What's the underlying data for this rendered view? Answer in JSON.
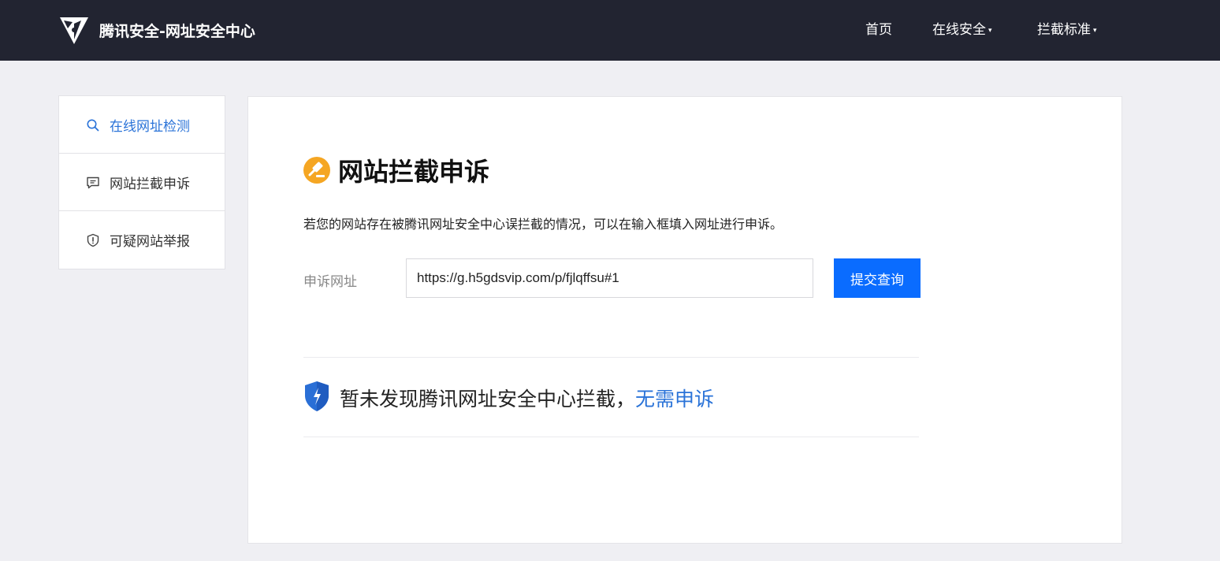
{
  "header": {
    "brand_title": "腾讯安全-网址安全中心",
    "logo_icon": "tencent-security-logo-icon",
    "nav": [
      {
        "label": "首页",
        "dropdown": false
      },
      {
        "label": "在线安全",
        "dropdown": true
      },
      {
        "label": "拦截标准",
        "dropdown": true
      }
    ],
    "caret": "▾"
  },
  "sidebar": {
    "items": [
      {
        "label": "在线网址检测",
        "icon": "search-icon",
        "active": true
      },
      {
        "label": "网站拦截申诉",
        "icon": "message-icon",
        "active": false
      },
      {
        "label": "可疑网站举报",
        "icon": "shield-alert-icon",
        "active": false
      }
    ]
  },
  "main": {
    "title": "网站拦截申诉",
    "title_icon": "gavel-icon",
    "description": "若您的网站存在被腾讯网址安全中心误拦截的情况，可以在输入框填入网址进行申诉。",
    "field_label": "申诉网址",
    "url_value": "https://g.h5gdsvip.com/p/fjlqffsu#1",
    "submit_label": "提交查询",
    "result_text": "暂未发现腾讯网址安全中心拦截，",
    "result_link": "无需申诉",
    "result_icon": "shield-check-icon"
  },
  "colors": {
    "header_bg": "#222431",
    "page_bg": "#efeff3",
    "accent_blue": "#0a6cff",
    "link_blue": "#2a73d8",
    "title_icon_orange": "#f5a623"
  }
}
